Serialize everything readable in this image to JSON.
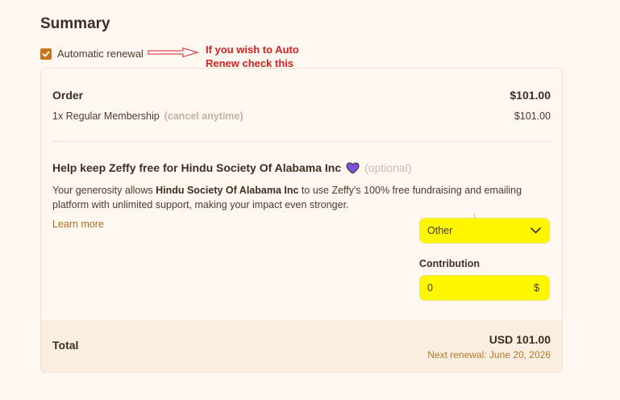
{
  "summary": {
    "title": "Summary",
    "auto_renew_label": "Automatic renewal",
    "auto_renew_checked": true,
    "annotation": "If you wish to Auto\nRenew check this"
  },
  "order": {
    "heading": "Order",
    "heading_amount": "$101.00",
    "item_label": "1x Regular Membership",
    "item_note": "(cancel anytime)",
    "item_amount": "$101.00"
  },
  "help": {
    "heading": "Help keep Zeffy free for Hindu Society Of Alabama Inc",
    "optional": "(optional)",
    "desc_prefix": "Your generosity allows ",
    "desc_org": "Hindu Society Of Alabama Inc",
    "desc_suffix": " to use Zeffy's 100% free fundraising and emailing platform with unlimited support, making your impact even stronger.",
    "learn_more": "Learn more",
    "select_value": "Other",
    "contribution_label": "Contribution",
    "contribution_value": "0",
    "currency_symbol": "$"
  },
  "total": {
    "label": "Total",
    "amount": "USD 101.00",
    "next_renewal": "Next renewal: June 20, 2026"
  },
  "colors": {
    "accent": "#c8731f",
    "highlight": "#fff700",
    "annotation": "#d42020",
    "heart": "#7b4fd6"
  },
  "icons": {
    "checkbox": "checkmark-icon",
    "heart": "heart-icon",
    "select": "chevron-down-icon",
    "annotation": "arrow-icon"
  }
}
